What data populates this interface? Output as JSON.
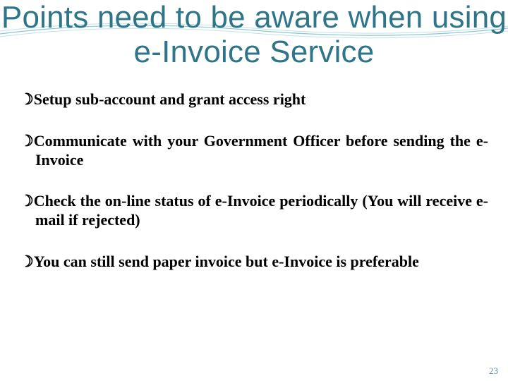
{
  "title": "Points need to be aware when using e-Invoice Service",
  "bullets": [
    "Setup sub-account and grant access right",
    "Communicate with your Government Officer before sending the e-Invoice",
    "Check the on-line status of e-Invoice periodically (You will receive e-mail if rejected)",
    "You can still send paper invoice but e-Invoice is preferable"
  ],
  "page_number": "23",
  "colors": {
    "title": "#2f7589",
    "wave_stroke": "#8bc7d6",
    "wave_stroke_light": "#bfe2ea",
    "page_number": "#5b8fa3"
  }
}
